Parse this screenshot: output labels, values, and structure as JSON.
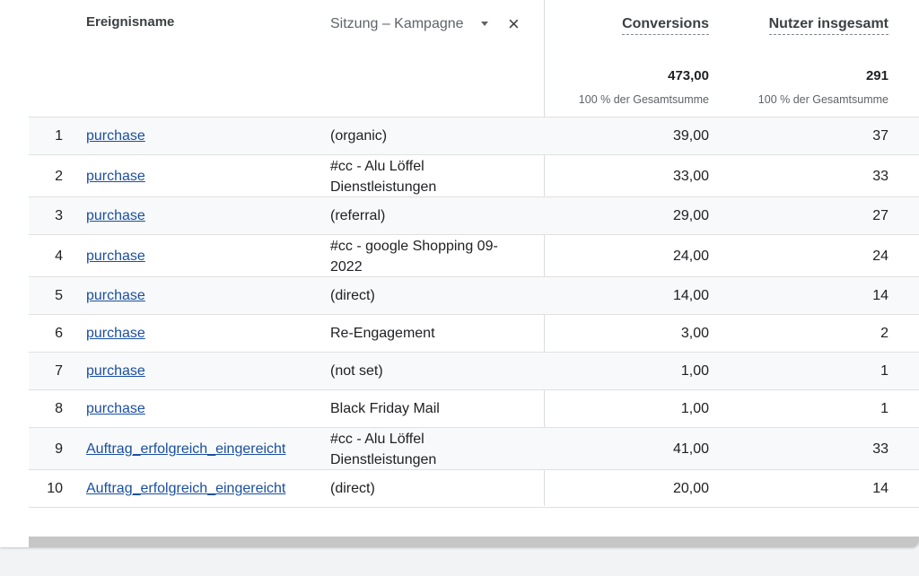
{
  "header": {
    "event_name": "Ereignisname",
    "dimension": "Sitzung – Kampagne",
    "close_symbol": "×",
    "metrics": [
      {
        "title": "Conversions",
        "total": "473,00",
        "pct": "100 % der Gesamtsumme"
      },
      {
        "title": "Nutzer insgesamt",
        "total": "291",
        "pct": "100 % der Gesamtsumme"
      }
    ]
  },
  "rows": [
    {
      "num": "1",
      "event": "purchase",
      "campaign": "(organic)",
      "conversions": "39,00",
      "users": "37"
    },
    {
      "num": "2",
      "event": "purchase",
      "campaign": "#cc - Alu Löffel Dienstleistungen",
      "conversions": "33,00",
      "users": "33"
    },
    {
      "num": "3",
      "event": "purchase",
      "campaign": "(referral)",
      "conversions": "29,00",
      "users": "27"
    },
    {
      "num": "4",
      "event": "purchase",
      "campaign": "#cc - google Shopping 09-2022",
      "conversions": "24,00",
      "users": "24"
    },
    {
      "num": "5",
      "event": "purchase",
      "campaign": "(direct)",
      "conversions": "14,00",
      "users": "14"
    },
    {
      "num": "6",
      "event": "purchase",
      "campaign": "Re-Engagement",
      "conversions": "3,00",
      "users": "2"
    },
    {
      "num": "7",
      "event": "purchase",
      "campaign": "(not set)",
      "conversions": "1,00",
      "users": "1"
    },
    {
      "num": "8",
      "event": "purchase",
      "campaign": "Black Friday Mail",
      "conversions": "1,00",
      "users": "1"
    },
    {
      "num": "9",
      "event": "Auftrag_erfolgreich_eingereicht",
      "campaign": "#cc - Alu Löffel Dienstleistungen",
      "conversions": "41,00",
      "users": "33"
    },
    {
      "num": "10",
      "event": "Auftrag_erfolgreich_eingereicht",
      "campaign": "(direct)",
      "conversions": "20,00",
      "users": "14"
    }
  ],
  "colors": {
    "link": "#1a4fa0",
    "stripe": "#f8f9fa",
    "divider": "#e0e0e0"
  }
}
